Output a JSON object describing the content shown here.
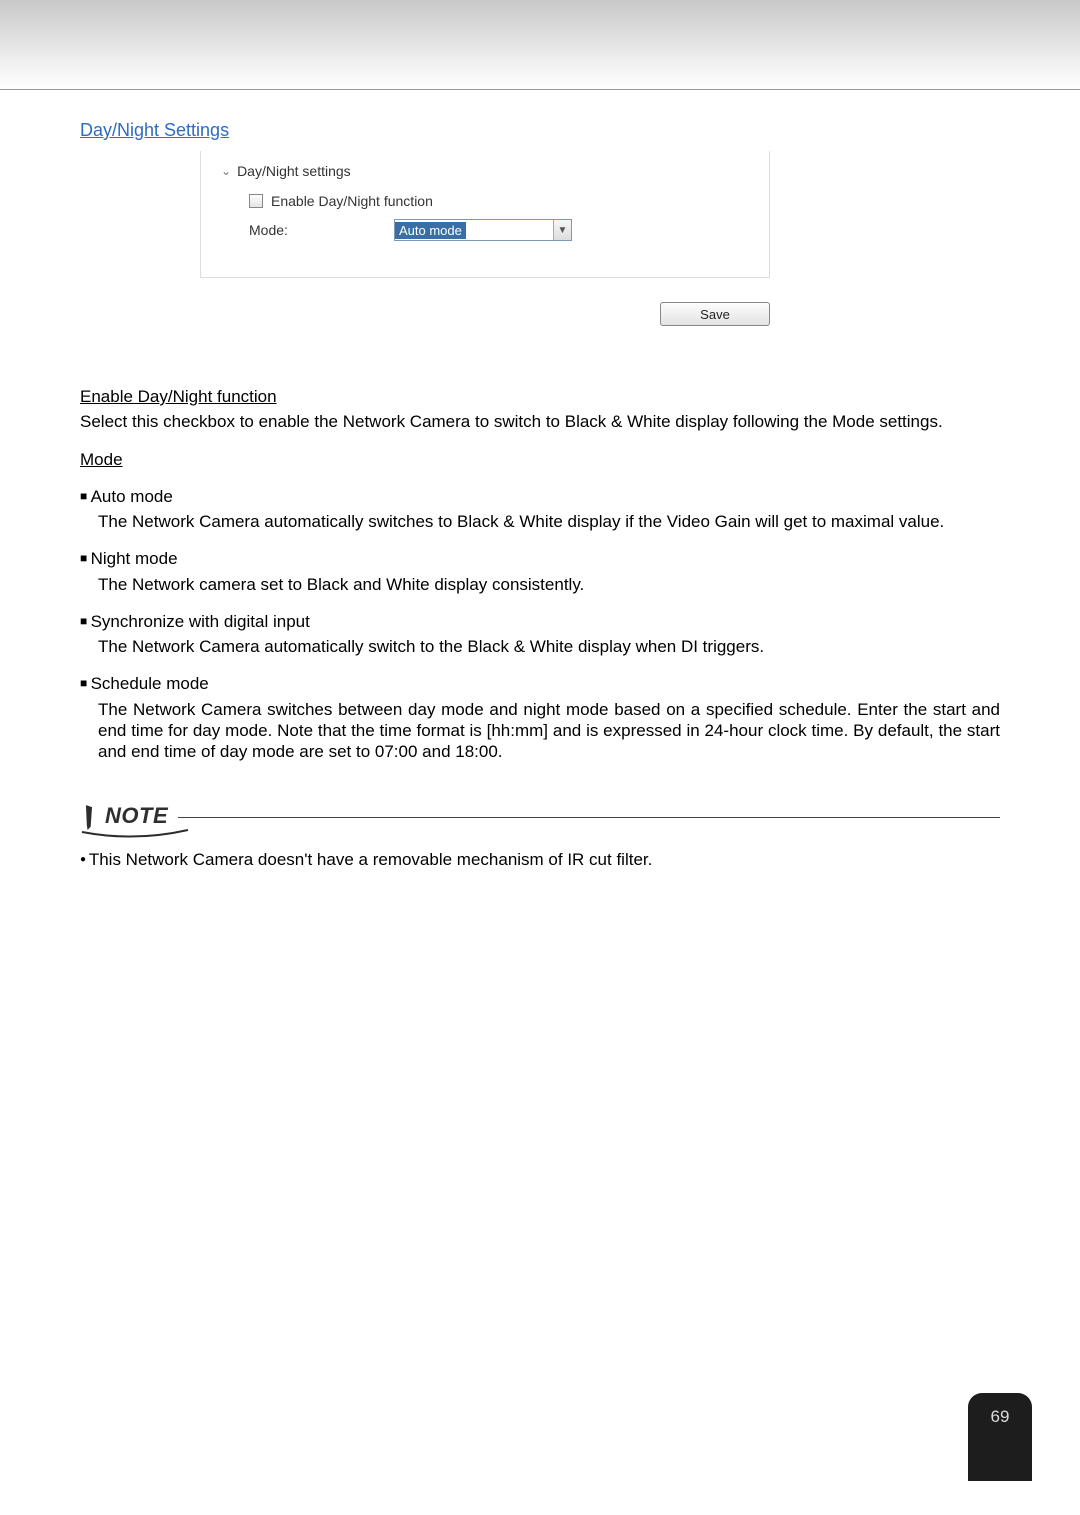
{
  "section_title": "Day/Night Settings",
  "panel": {
    "header": "Day/Night settings",
    "enable_label": "Enable Day/Night function",
    "mode_label": "Mode:",
    "mode_selected": "Auto mode",
    "save_label": "Save"
  },
  "doc": {
    "enable_heading": "Enable Day/Night function",
    "enable_desc": "Select this checkbox to enable the Network Camera to switch to Black & White display following the Mode settings.",
    "mode_heading": "Mode",
    "modes": [
      {
        "title": "Auto mode",
        "desc": "The Network Camera automatically switches to Black & White display if the Video Gain will get to maximal value."
      },
      {
        "title": "Night mode",
        "desc": "The Network camera set to Black and White display consistently."
      },
      {
        "title": "Synchronize with digital input",
        "desc": "The Network Camera automatically switch to the Black & White display when DI triggers."
      },
      {
        "title": "Schedule mode",
        "desc": "The Network Camera switches between day mode and night mode based on a specified schedule. Enter the start and end time for day mode. Note that the time format is [hh:mm] and is expressed in 24-hour clock time. By default, the start and end time of day mode are set to 07:00 and 18:00."
      }
    ]
  },
  "note": {
    "heading": "NOTE",
    "body": "This Network Camera doesn't have a removable mechanism of IR cut filter."
  },
  "page_number": "69"
}
